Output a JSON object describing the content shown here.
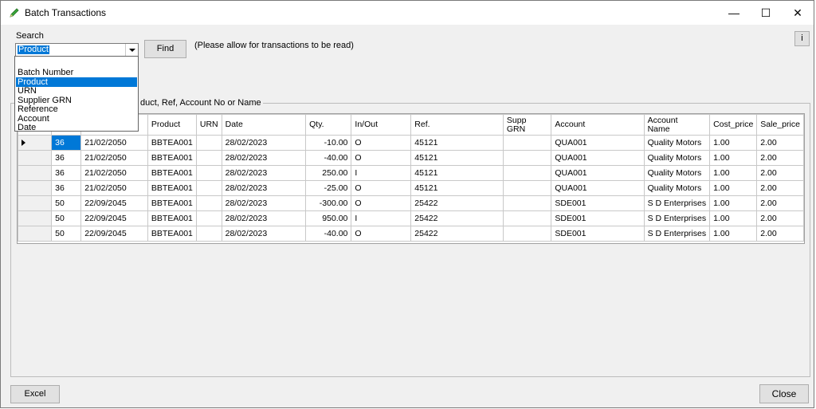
{
  "window": {
    "title": "Batch Transactions",
    "minimize": "—",
    "maximize": "☐",
    "close": "✕"
  },
  "search": {
    "label": "Search",
    "selected": "Product",
    "find_label": "Find",
    "note": "(Please allow for transactions to be read)",
    "info_label": "i",
    "options": [
      "Batch Number",
      "Product",
      "URN",
      "Supplier GRN",
      "Reference",
      "Account",
      "Date"
    ],
    "group_title_visible": "duct, Ref, Account No or Name"
  },
  "table": {
    "headers": [
      "",
      "",
      "",
      "Product",
      "URN",
      "Date",
      "Qty.",
      "In/Out",
      "Ref.",
      "Supp\nGRN",
      "Account",
      "Account\nName",
      "Cost_price",
      "Sale_price"
    ],
    "rows": [
      [
        "36",
        "21/02/2050",
        "BBTEA001",
        "",
        "28/02/2023",
        "-10.00",
        "O",
        "45121",
        "",
        "QUA001",
        "Quality Motors",
        "1.00",
        "2.00"
      ],
      [
        "36",
        "21/02/2050",
        "BBTEA001",
        "",
        "28/02/2023",
        "-40.00",
        "O",
        "45121",
        "",
        "QUA001",
        "Quality Motors",
        "1.00",
        "2.00"
      ],
      [
        "36",
        "21/02/2050",
        "BBTEA001",
        "",
        "28/02/2023",
        "250.00",
        "I",
        "45121",
        "",
        "QUA001",
        "Quality Motors",
        "1.00",
        "2.00"
      ],
      [
        "36",
        "21/02/2050",
        "BBTEA001",
        "",
        "28/02/2023",
        "-25.00",
        "O",
        "45121",
        "",
        "QUA001",
        "Quality Motors",
        "1.00",
        "2.00"
      ],
      [
        "50",
        "22/09/2045",
        "BBTEA001",
        "",
        "28/02/2023",
        "-300.00",
        "O",
        "25422",
        "",
        "SDE001",
        "S D Enterprises",
        "1.00",
        "2.00"
      ],
      [
        "50",
        "22/09/2045",
        "BBTEA001",
        "",
        "28/02/2023",
        "950.00",
        "I",
        "25422",
        "",
        "SDE001",
        "S D Enterprises",
        "1.00",
        "2.00"
      ],
      [
        "50",
        "22/09/2045",
        "BBTEA001",
        "",
        "28/02/2023",
        "-40.00",
        "O",
        "25422",
        "",
        "SDE001",
        "S D Enterprises",
        "1.00",
        "2.00"
      ]
    ]
  },
  "footer": {
    "excel_label": "Excel",
    "close_label": "Close"
  },
  "colors": {
    "selection": "#0078d7",
    "window_bg": "#f0f0f0"
  },
  "icons": {
    "title": "green-pencil-icon",
    "row_indicator": "row-pointer-icon"
  }
}
